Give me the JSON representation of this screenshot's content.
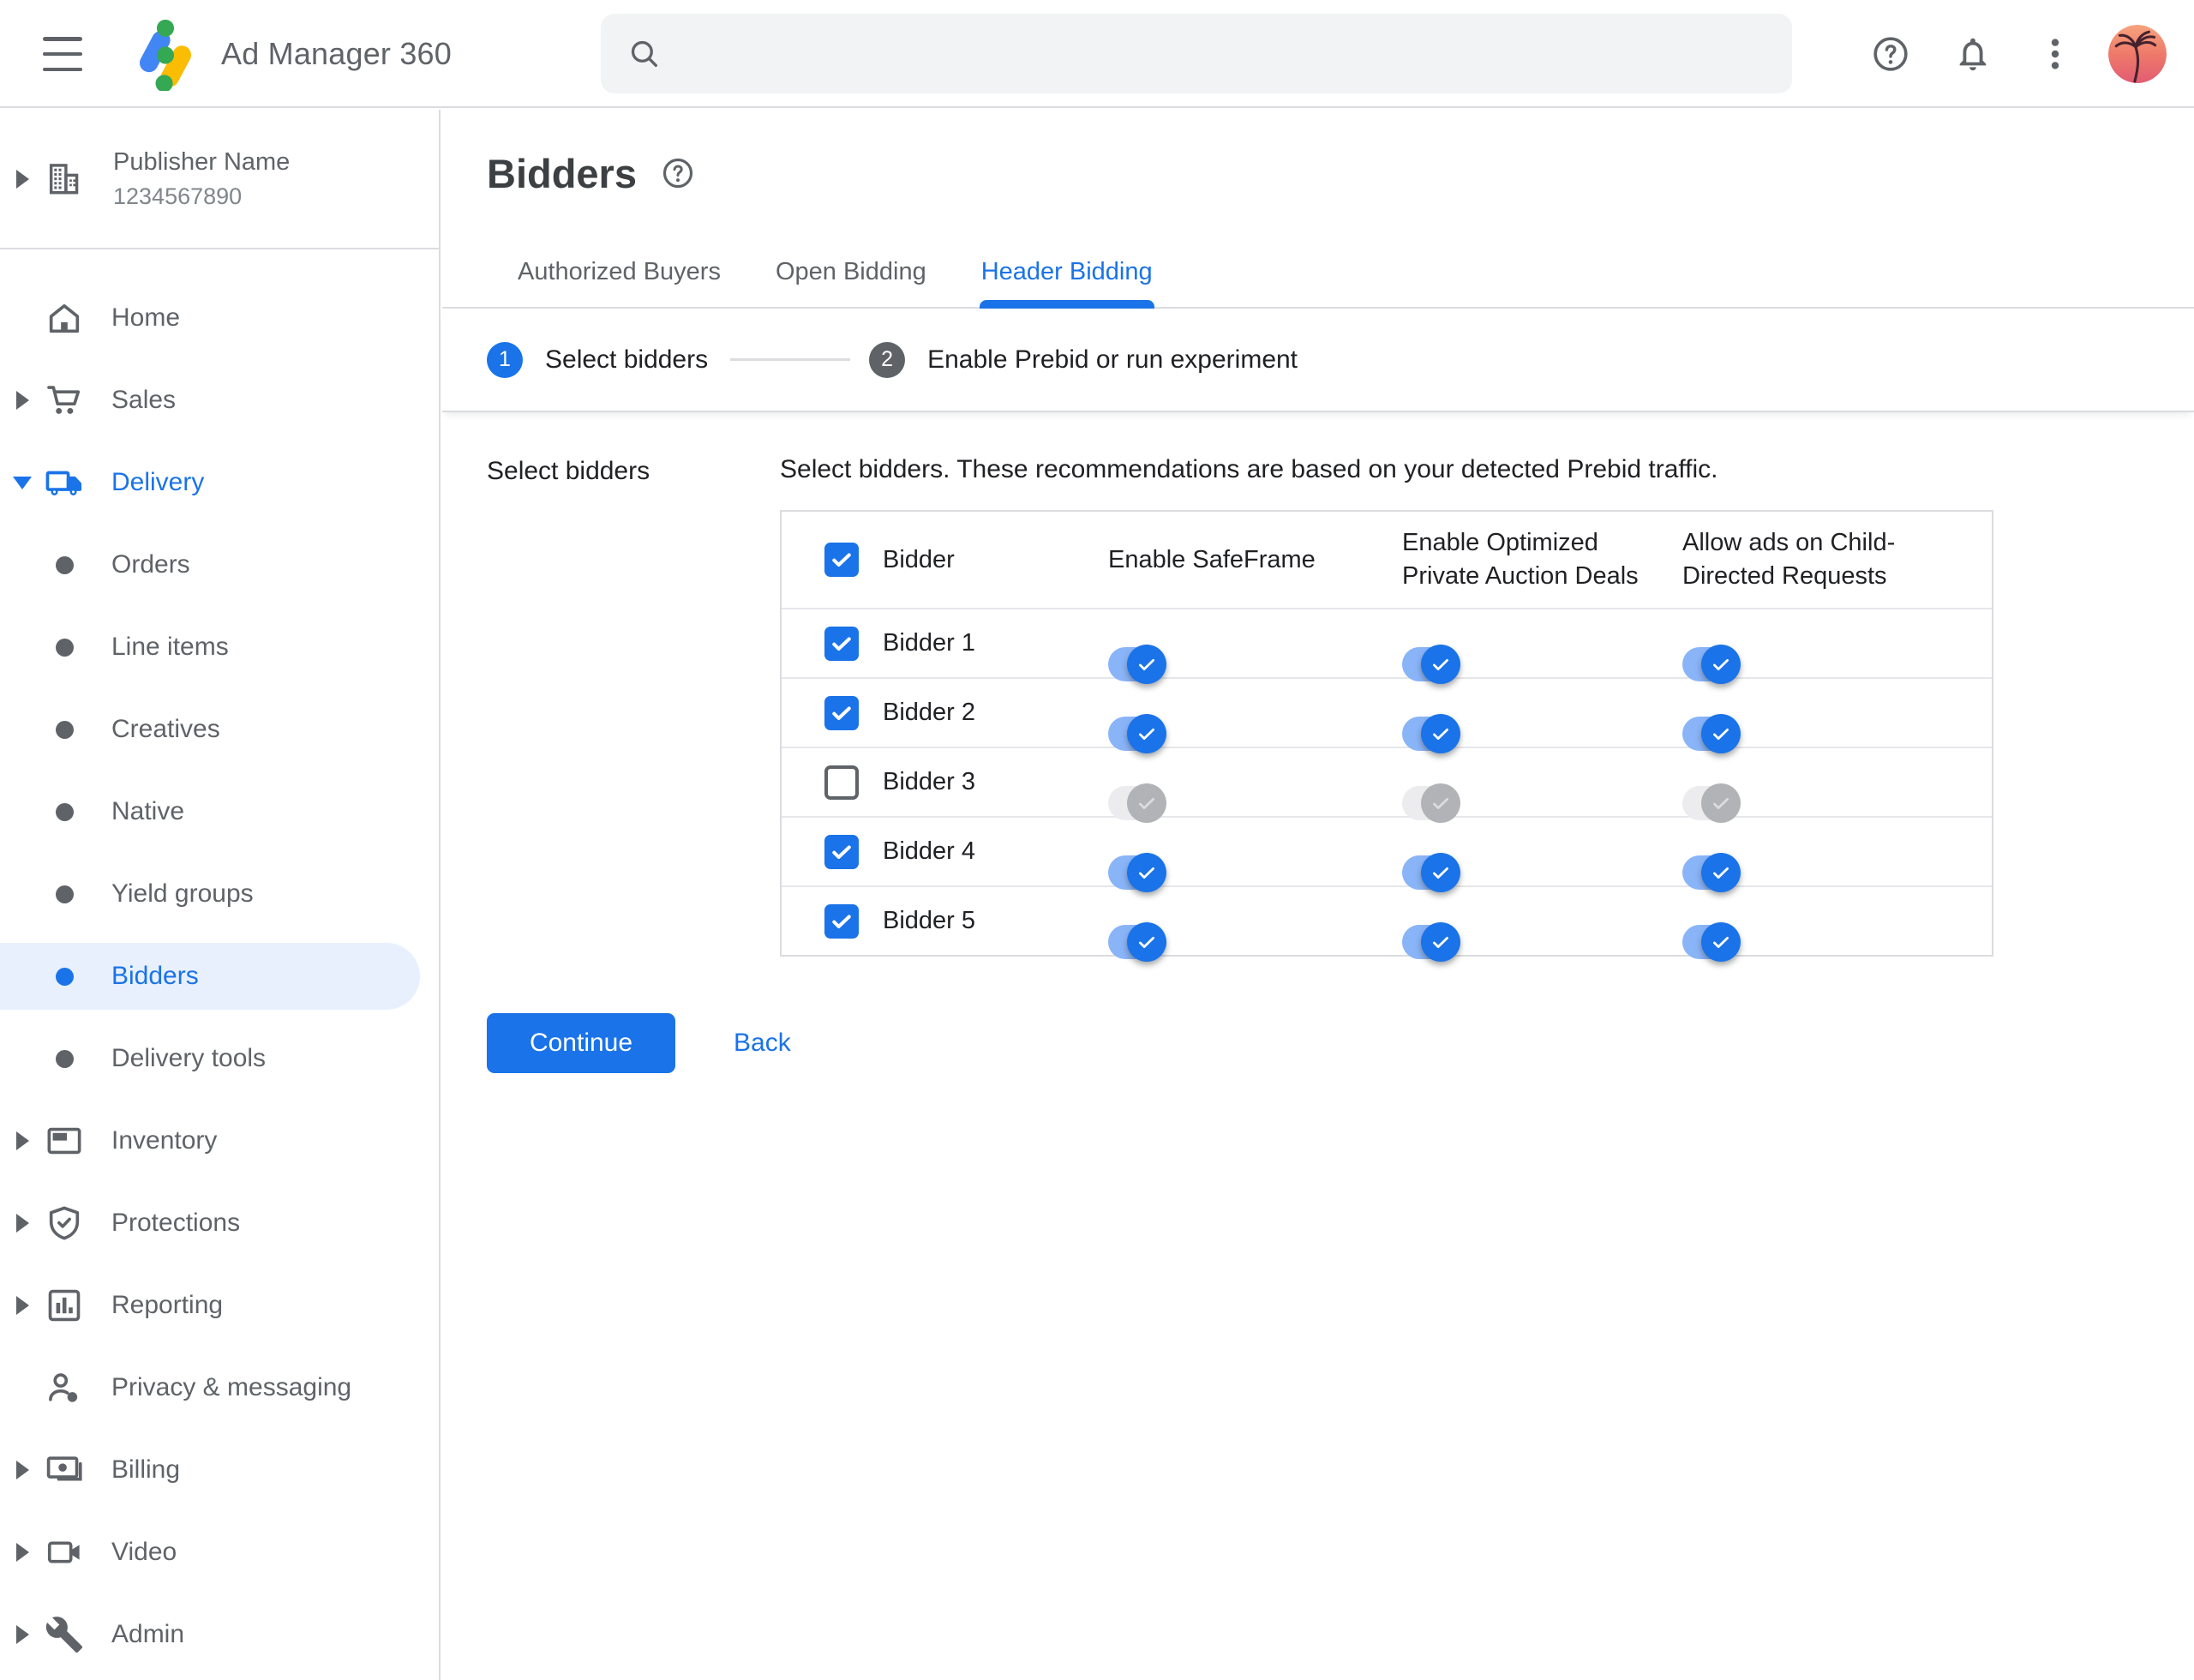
{
  "topbar": {
    "app_name": "Ad Manager 360",
    "search_placeholder": ""
  },
  "sidebar": {
    "publisher_name": "Publisher Name",
    "publisher_id": "1234567890",
    "items": [
      {
        "label": "Home"
      },
      {
        "label": "Sales"
      },
      {
        "label": "Delivery"
      },
      {
        "label": "Orders"
      },
      {
        "label": "Line items"
      },
      {
        "label": "Creatives"
      },
      {
        "label": "Native"
      },
      {
        "label": "Yield groups"
      },
      {
        "label": "Bidders"
      },
      {
        "label": "Delivery tools"
      },
      {
        "label": "Inventory"
      },
      {
        "label": "Protections"
      },
      {
        "label": "Reporting"
      },
      {
        "label": "Privacy & messaging"
      },
      {
        "label": "Billing"
      },
      {
        "label": "Video"
      },
      {
        "label": "Admin"
      }
    ],
    "selected_item": "Bidders",
    "expanded_item": "Delivery"
  },
  "page": {
    "title": "Bidders"
  },
  "tabs": [
    {
      "label": "Authorized Buyers",
      "active": false
    },
    {
      "label": "Open Bidding",
      "active": false
    },
    {
      "label": "Header Bidding",
      "active": true
    }
  ],
  "stepper": [
    {
      "number": "1",
      "label": "Select bidders",
      "active": true
    },
    {
      "number": "2",
      "label": "Enable Prebid or run experiment",
      "active": false
    }
  ],
  "form": {
    "section_label": "Select bidders",
    "description": "Select bidders. These recommendations are based on your detected Prebid traffic."
  },
  "table": {
    "headers": [
      "Bidder",
      "Enable SafeFrame",
      "Enable Optimized Private Auction Deals",
      "Allow ads on Child-Directed Requests"
    ],
    "header_checkbox_checked": true,
    "rows": [
      {
        "name": "Bidder 1",
        "selected": true,
        "safeframe": true,
        "optimized_deals": true,
        "child_directed": true
      },
      {
        "name": "Bidder 2",
        "selected": true,
        "safeframe": true,
        "optimized_deals": true,
        "child_directed": true
      },
      {
        "name": "Bidder 3",
        "selected": false,
        "safeframe": false,
        "optimized_deals": false,
        "child_directed": false
      },
      {
        "name": "Bidder 4",
        "selected": true,
        "safeframe": true,
        "optimized_deals": true,
        "child_directed": true
      },
      {
        "name": "Bidder 5",
        "selected": true,
        "safeframe": true,
        "optimized_deals": true,
        "child_directed": true
      }
    ]
  },
  "actions": {
    "continue_label": "Continue",
    "back_label": "Back"
  },
  "colors": {
    "accent": "#1a73e8",
    "accent_light_track": "#8ab4f8",
    "selected_item_bg": "#e8f0fe",
    "border": "#dadce0",
    "text_dark": "#202124",
    "text_gray": "#5f6368",
    "disabled_track": "#ececee",
    "disabled_thumb": "#b2b3b7",
    "search_bg": "#f1f3f4",
    "logo_blue": "#4285f4",
    "logo_yellow": "#fbbc04",
    "logo_green": "#34a853"
  }
}
